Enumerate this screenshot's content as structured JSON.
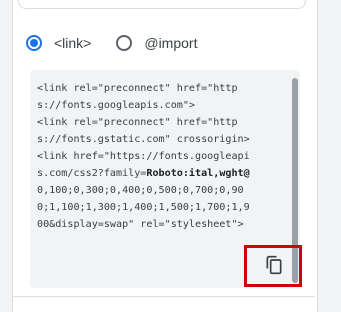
{
  "embed_options": {
    "link_label": "<link>",
    "import_label": "@import",
    "selected": "link"
  },
  "code_snippet": {
    "lines": [
      "<link rel=\"preconnect\" href=\"http",
      "s://fonts.googleapis.com\">",
      "<link rel=\"preconnect\" href=\"http",
      "s://fonts.gstatic.com\" crossorigin>",
      "<link href=\"https://fonts.googleapi",
      "s.com/css2?family=",
      "Roboto:ital,wght@",
      "0,100;0,300;0,400;0,500;0,700;0,90",
      "0;1,100;1,300;1,400;1,500;1,700;1,9",
      "00&display=swap\" rel=\"stylesheet\">"
    ]
  },
  "icons": {
    "copy": "copy-icon"
  },
  "colors": {
    "accent": "#1a73e8",
    "highlight": "#d50000",
    "code_bg": "#f1f3f4"
  }
}
